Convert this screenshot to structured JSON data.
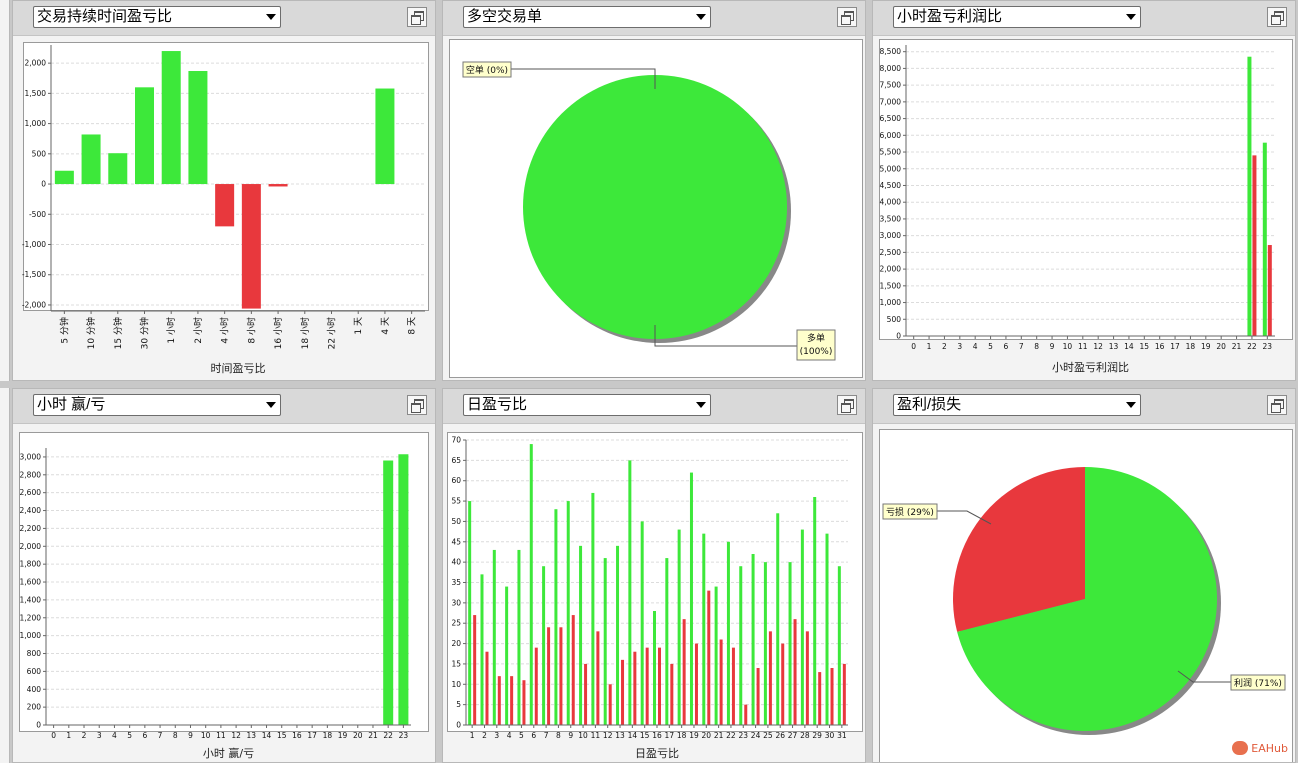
{
  "colors": {
    "profit": "#3de83a",
    "loss": "#e8383d",
    "shadow": "#888888"
  },
  "panels": [
    {
      "id": "duration",
      "select": "交易持续时间盈亏比",
      "title": "时间盈亏比"
    },
    {
      "id": "longshort",
      "select": "多空交易单",
      "title": ""
    },
    {
      "id": "hourprofit",
      "select": "小时盈亏利润比",
      "title": "小时盈亏利润比"
    },
    {
      "id": "hourwinloss",
      "select": "小时 赢/亏",
      "title": "小时 赢/亏"
    },
    {
      "id": "daily",
      "select": "日盈亏比",
      "title": "日盈亏比"
    },
    {
      "id": "pl",
      "select": "盈利/损失",
      "title": ""
    }
  ],
  "chart_data": [
    {
      "type": "bar",
      "title": "时间盈亏比",
      "categories": [
        "5 分钟",
        "10 分钟",
        "15 分钟",
        "30 分钟",
        "1 小时",
        "2 小时",
        "4 小时",
        "8 小时",
        "16 小时",
        "18 小时",
        "22 小时",
        "1 天",
        "4 天",
        "8 天"
      ],
      "values": [
        220,
        820,
        510,
        1600,
        2200,
        1870,
        -700,
        -2060,
        -40,
        0,
        0,
        0,
        1580,
        0
      ],
      "yticks": [
        -2000,
        -1500,
        -1000,
        -500,
        0,
        500,
        1000,
        1500,
        2000
      ],
      "ytick_labels": [
        "-2,000",
        "-1,500",
        "-1,000",
        "-500",
        "0",
        "500",
        "1,000",
        "1,500",
        "2,000"
      ],
      "ylim": [
        -2100,
        2300
      ],
      "grid": true
    },
    {
      "type": "pie",
      "slices": [
        {
          "label": "空单",
          "pct": "(0%)",
          "value": 0
        },
        {
          "label": "多单",
          "pct": "(100%)",
          "value": 100
        }
      ]
    },
    {
      "type": "bar",
      "title": "小时盈亏利润比",
      "categories": [
        "0",
        "1",
        "2",
        "3",
        "4",
        "5",
        "6",
        "7",
        "8",
        "9",
        "10",
        "11",
        "12",
        "13",
        "14",
        "15",
        "16",
        "17",
        "18",
        "19",
        "20",
        "21",
        "22",
        "23"
      ],
      "series": [
        {
          "values": [
            0,
            0,
            0,
            0,
            0,
            0,
            0,
            0,
            0,
            0,
            0,
            0,
            0,
            0,
            0,
            0,
            0,
            0,
            0,
            0,
            0,
            0,
            8350,
            5780
          ]
        },
        {
          "values": [
            0,
            0,
            0,
            0,
            0,
            0,
            0,
            0,
            0,
            0,
            0,
            0,
            0,
            0,
            0,
            0,
            0,
            0,
            0,
            0,
            0,
            0,
            5400,
            2720
          ]
        }
      ],
      "yticks": [
        0,
        500,
        1000,
        1500,
        2000,
        2500,
        3000,
        3500,
        4000,
        4500,
        5000,
        5500,
        6000,
        6500,
        7000,
        7500,
        8000,
        8500
      ],
      "ytick_labels": [
        "0",
        "500",
        "1,000",
        "1,500",
        "2,000",
        "2,500",
        "3,000",
        "3,500",
        "4,000",
        "4,500",
        "5,000",
        "5,500",
        "6,000",
        "6,500",
        "7,000",
        "7,500",
        "8,000",
        "8,500"
      ],
      "ylim": [
        0,
        8700
      ],
      "grid": true
    },
    {
      "type": "bar",
      "title": "小时 赢/亏",
      "categories": [
        "0",
        "1",
        "2",
        "3",
        "4",
        "5",
        "6",
        "7",
        "8",
        "9",
        "10",
        "11",
        "12",
        "13",
        "14",
        "15",
        "16",
        "17",
        "18",
        "19",
        "20",
        "21",
        "22",
        "23"
      ],
      "values": [
        0,
        0,
        0,
        0,
        0,
        0,
        0,
        0,
        0,
        0,
        0,
        0,
        0,
        0,
        0,
        0,
        0,
        0,
        0,
        0,
        0,
        0,
        2960,
        3030
      ],
      "yticks": [
        0,
        200,
        400,
        600,
        800,
        1000,
        1200,
        1400,
        1600,
        1800,
        2000,
        2200,
        2400,
        2600,
        2800,
        3000
      ],
      "ytick_labels": [
        "0",
        "200",
        "400",
        "600",
        "800",
        "1,000",
        "1,200",
        "1,400",
        "1,600",
        "1,800",
        "2,000",
        "2,200",
        "2,400",
        "2,600",
        "2,800",
        "3,000"
      ],
      "ylim": [
        0,
        3100
      ],
      "grid": true
    },
    {
      "type": "bar",
      "title": "日盈亏比",
      "categories": [
        "1",
        "2",
        "3",
        "4",
        "5",
        "6",
        "7",
        "8",
        "9",
        "10",
        "11",
        "12",
        "13",
        "14",
        "15",
        "16",
        "17",
        "18",
        "19",
        "20",
        "21",
        "22",
        "23",
        "24",
        "25",
        "26",
        "27",
        "28",
        "29",
        "30",
        "31"
      ],
      "series": [
        {
          "values": [
            55,
            37,
            43,
            34,
            43,
            69,
            39,
            53,
            55,
            44,
            57,
            41,
            44,
            65,
            50,
            28,
            41,
            48,
            62,
            47,
            34,
            45,
            39,
            42,
            40,
            52,
            40,
            48,
            56,
            47,
            39
          ]
        },
        {
          "values": [
            27,
            18,
            12,
            12,
            11,
            19,
            24,
            24,
            27,
            15,
            23,
            10,
            16,
            18,
            19,
            19,
            15,
            26,
            20,
            33,
            21,
            19,
            5,
            14,
            23,
            20,
            26,
            23,
            13,
            14,
            15
          ]
        }
      ],
      "yticks": [
        0,
        5,
        10,
        15,
        20,
        25,
        30,
        35,
        40,
        45,
        50,
        55,
        60,
        65,
        70
      ],
      "ytick_labels": [
        "0",
        "5",
        "10",
        "15",
        "20",
        "25",
        "30",
        "35",
        "40",
        "45",
        "50",
        "55",
        "60",
        "65",
        "70"
      ],
      "ylim": [
        0,
        70
      ],
      "grid": true
    },
    {
      "type": "pie",
      "slices": [
        {
          "label": "亏损",
          "pct": "(29%)",
          "value": 29
        },
        {
          "label": "利润",
          "pct": "(71%)",
          "value": 71
        }
      ]
    }
  ],
  "watermark": "EAHub"
}
